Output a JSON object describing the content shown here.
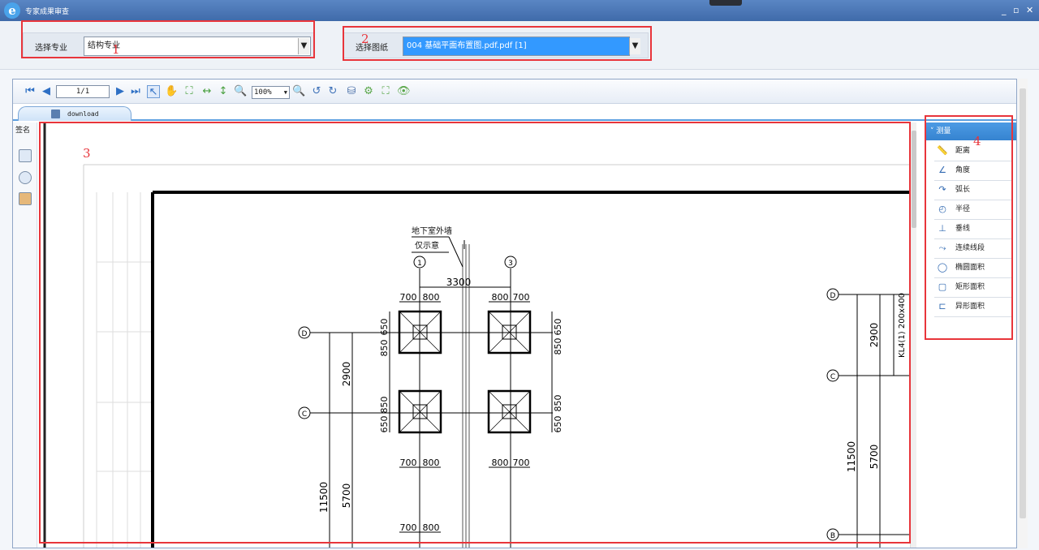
{
  "window": {
    "title": "专家成果审查",
    "controls": [
      "_",
      "▫",
      "✕"
    ]
  },
  "topbar": {
    "specialty": {
      "label": "选择专业",
      "value": "结构专业"
    },
    "drawing": {
      "label": "选择图纸",
      "value": "004 基础平面布置图.pdf.pdf  [1]"
    }
  },
  "annotations": [
    "1",
    "2",
    "3",
    "4"
  ],
  "toolbar": {
    "page": "1/1",
    "zoom": "100%"
  },
  "tab": {
    "label": "download"
  },
  "leftrail": {
    "label": "签名"
  },
  "panel": {
    "header": "测量",
    "tools": [
      {
        "icon": "ruler-icon",
        "glyph": "📏",
        "label": "距离"
      },
      {
        "icon": "angle-icon",
        "glyph": "∠",
        "label": "角度"
      },
      {
        "icon": "arc-icon",
        "glyph": "↷",
        "label": "弧长"
      },
      {
        "icon": "radius-icon",
        "glyph": "◴",
        "label": "半径"
      },
      {
        "icon": "perpendicular-icon",
        "glyph": "⊥",
        "label": "垂线"
      },
      {
        "icon": "polyline-icon",
        "glyph": "⤳",
        "label": "连续线段"
      },
      {
        "icon": "ellipse-icon",
        "glyph": "◯",
        "label": "椭圆面积"
      },
      {
        "icon": "rectangle-icon",
        "glyph": "▢",
        "label": "矩形面积"
      },
      {
        "icon": "polygon-icon",
        "glyph": "⊏",
        "label": "异形面积"
      }
    ]
  },
  "drawing": {
    "note1": "地下室外墙",
    "note2": "仅示意",
    "axis_1": "1",
    "axis_3": "3",
    "axis_D": "D",
    "axis_C": "C",
    "axis_B": "B",
    "dim_3300": "3300",
    "dim_700": "700",
    "dim_800": "800",
    "dim_650": "650",
    "dim_850": "850",
    "dim_2900": "2900",
    "dim_5700": "5700",
    "dim_11500": "11500",
    "beam": "KL4(1) 200x400"
  }
}
